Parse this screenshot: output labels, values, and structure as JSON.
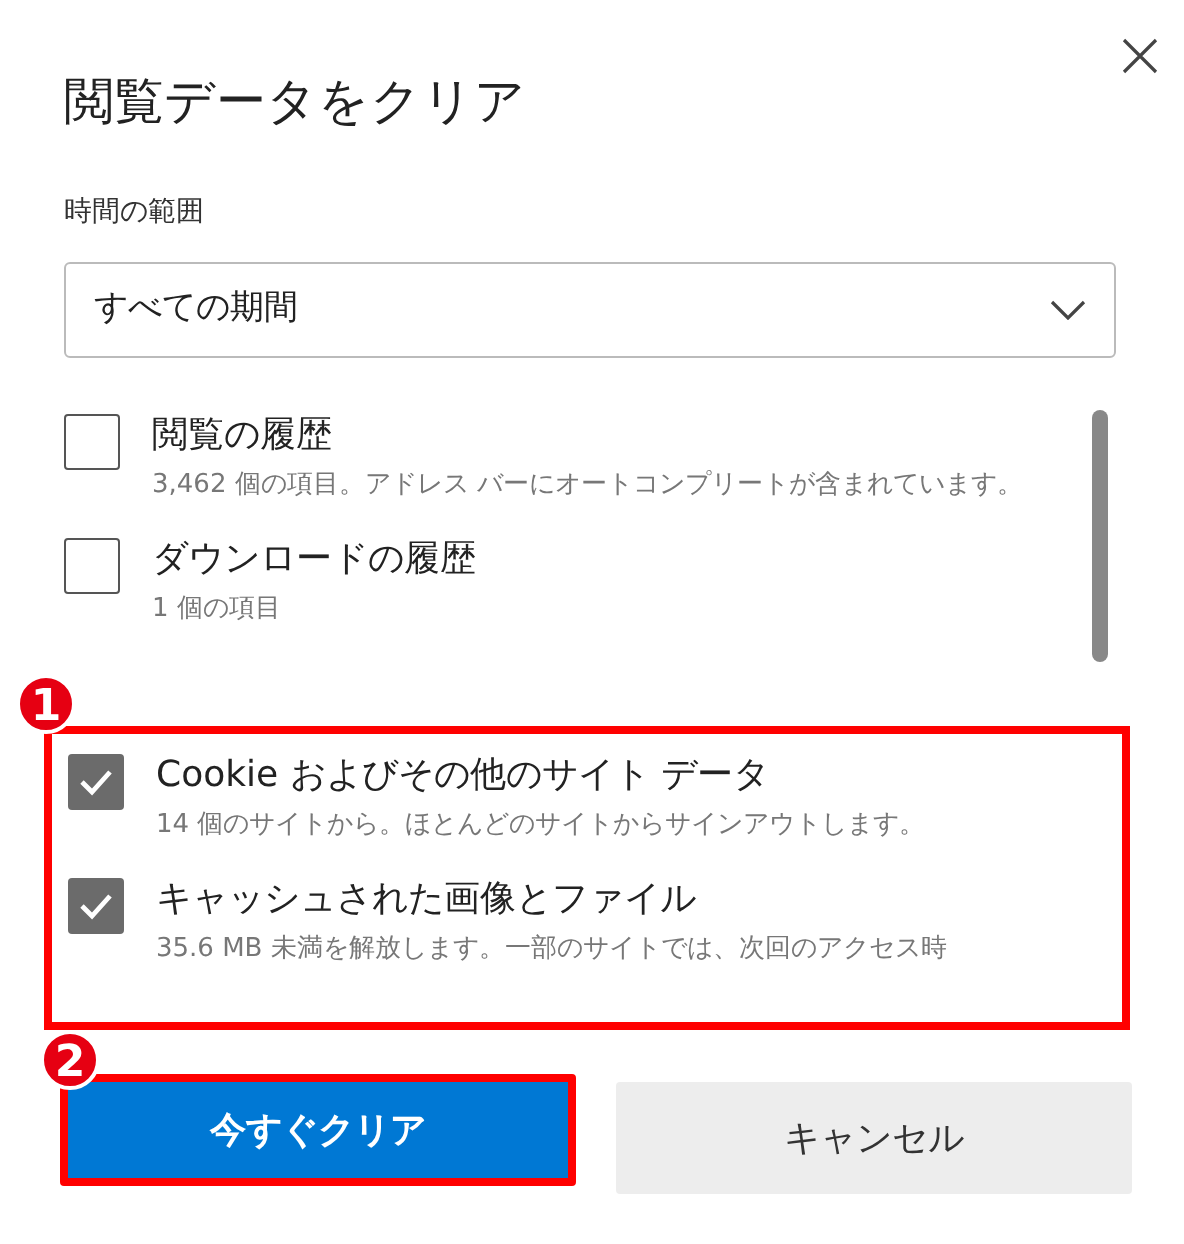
{
  "dialog": {
    "title": "閲覧データをクリア",
    "time_range": {
      "label": "時間の範囲",
      "value": "すべての期間"
    },
    "items": [
      {
        "label": "閲覧の履歴",
        "description": "3,462 個の項目。アドレス バーにオートコンプリートが含まれています。",
        "checked": false,
        "highlighted": false
      },
      {
        "label": "ダウンロードの履歴",
        "description": "1 個の項目",
        "checked": false,
        "highlighted": false
      },
      {
        "label": "Cookie およびその他のサイト データ",
        "description": "14 個のサイトから。ほとんどのサイトからサインアウトします。",
        "checked": true,
        "highlighted": true
      },
      {
        "label": "キャッシュされた画像とファイル",
        "description": "35.6 MB 未満を解放します。一部のサイトでは、次回のアクセス時",
        "checked": true,
        "highlighted": true
      }
    ],
    "buttons": [
      {
        "label": "今すぐクリア",
        "kind": "primary",
        "highlighted": true
      },
      {
        "label": "キャンセル",
        "kind": "secondary",
        "highlighted": false
      }
    ],
    "annotations": [
      {
        "label": "1"
      },
      {
        "label": "2"
      }
    ]
  }
}
